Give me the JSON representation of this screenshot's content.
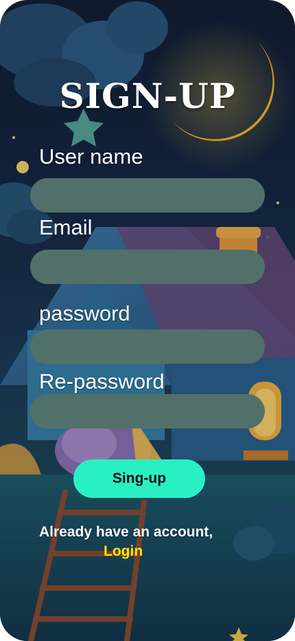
{
  "page": {
    "title": "SIGN-UP"
  },
  "form": {
    "fields": [
      {
        "label": "User name",
        "value": ""
      },
      {
        "label": "Email",
        "value": ""
      },
      {
        "label": "password",
        "value": ""
      },
      {
        "label": "Re-password",
        "value": ""
      }
    ],
    "submit_label": "Sing-up"
  },
  "footer": {
    "account_text": "Already have an account,",
    "login_label": "Login"
  },
  "colors": {
    "field_background": "#52706a",
    "button_background": "#29f0c3",
    "login_link": "#ffe600"
  }
}
